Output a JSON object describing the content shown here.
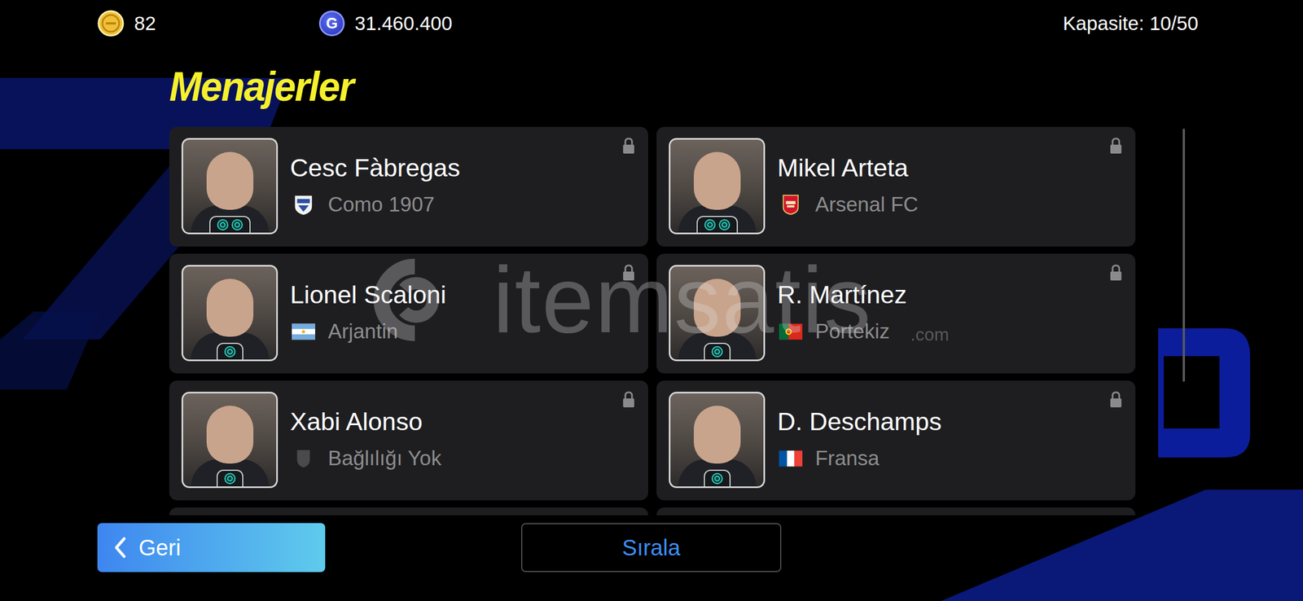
{
  "currency": {
    "coins": "82",
    "gp_icon": "G",
    "gp": "31.460.400"
  },
  "capacity": "Kapasite: 10/50",
  "title": "Menajerler",
  "managers": [
    {
      "name": "Cesc Fàbregas",
      "team": "Como 1907",
      "kind": "club",
      "badges": 2,
      "locked": true
    },
    {
      "name": "Mikel Arteta",
      "team": "Arsenal FC",
      "kind": "club",
      "badges": 2,
      "locked": true
    },
    {
      "name": "Lionel Scaloni",
      "team": "Arjantin",
      "kind": "country",
      "badges": 1,
      "locked": true
    },
    {
      "name": "R. Martínez",
      "team": "Portekiz",
      "kind": "country",
      "badges": 1,
      "locked": true
    },
    {
      "name": "Xabi Alonso",
      "team": "Bağlılığı Yok",
      "kind": "none",
      "badges": 1,
      "locked": true
    },
    {
      "name": "D. Deschamps",
      "team": "Fransa",
      "kind": "country",
      "badges": 1,
      "locked": true
    }
  ],
  "watermark": {
    "text": "itemsatis",
    "suffix": ".com"
  },
  "buttons": {
    "back": "Geri",
    "sort": "Sırala"
  }
}
